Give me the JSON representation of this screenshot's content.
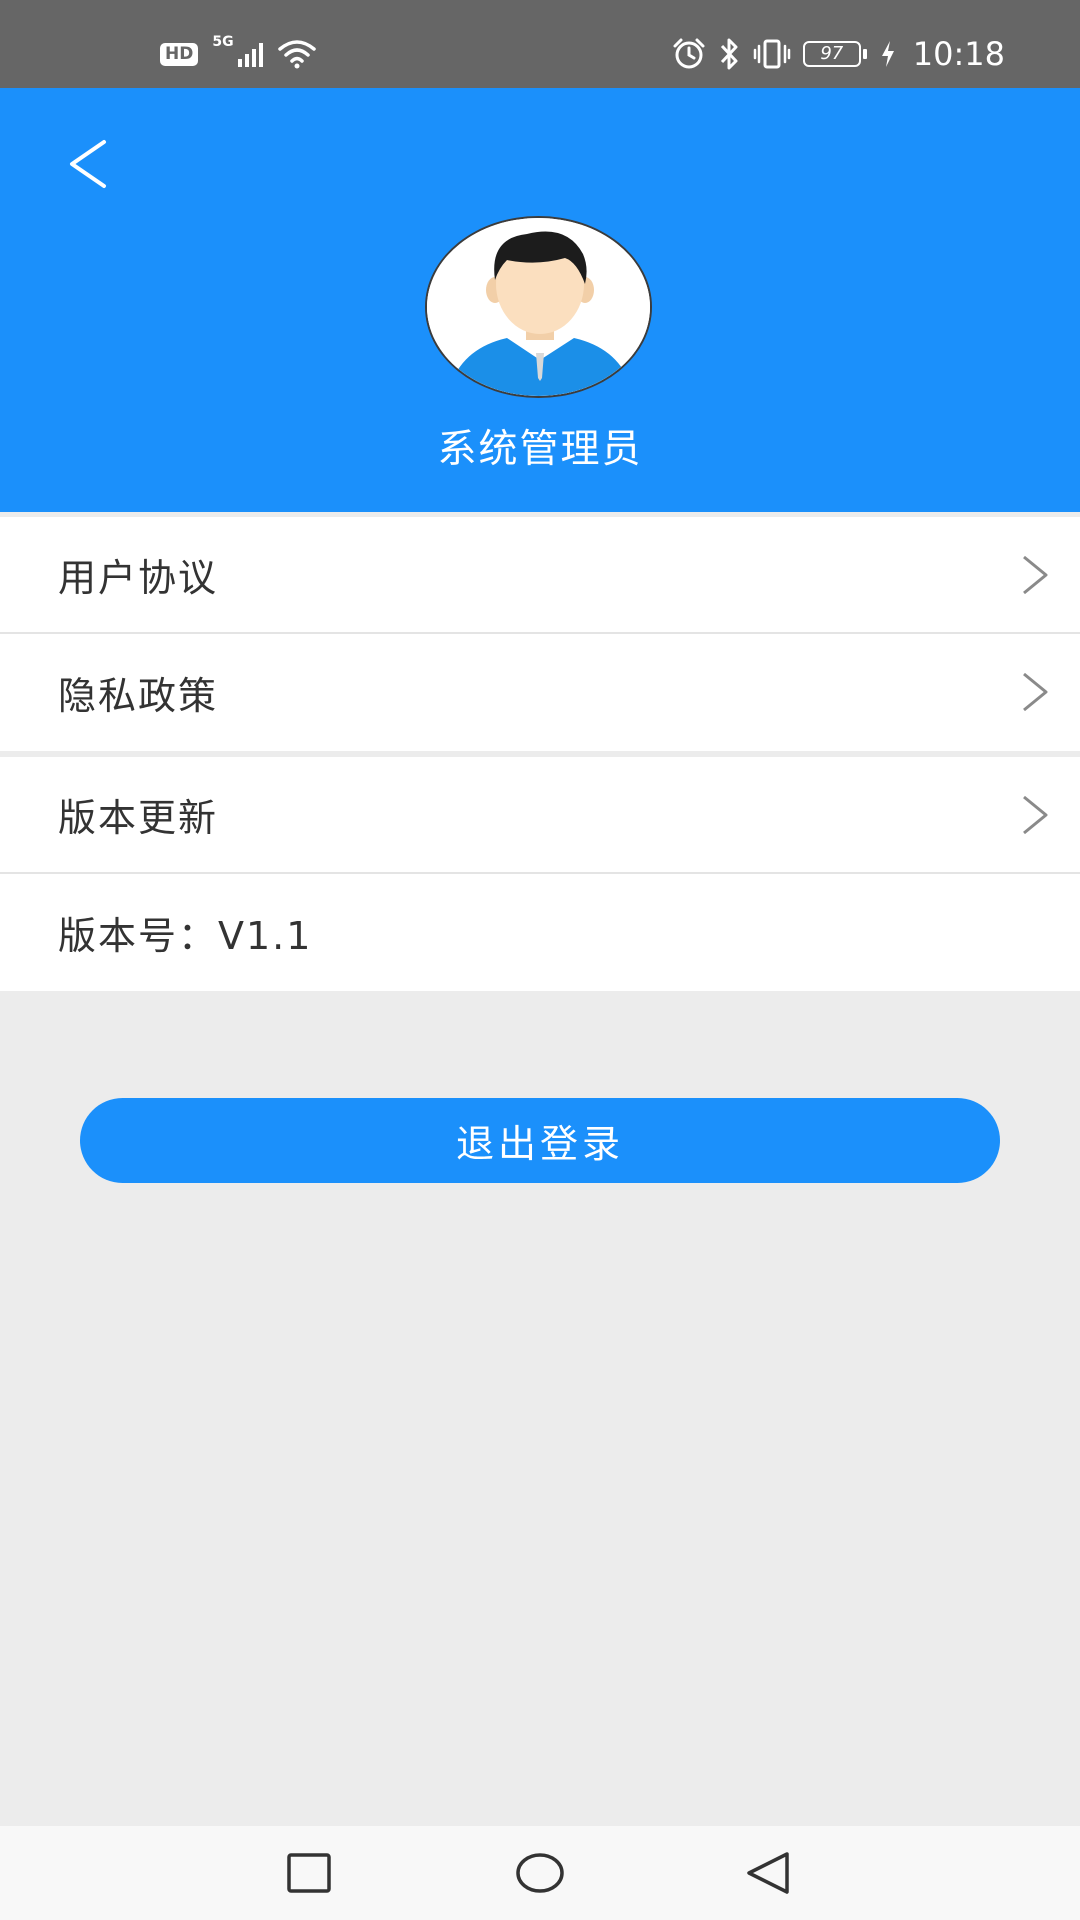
{
  "status_bar": {
    "hd": "HD",
    "network": "5G",
    "battery": "97",
    "time": "10:18",
    "icons": [
      "hd-icon",
      "signal-icon",
      "wifi-icon",
      "alarm-icon",
      "bluetooth-icon",
      "vibrate-icon",
      "battery-icon",
      "charging-icon"
    ]
  },
  "header": {
    "back_icon": "chevron-left-icon",
    "avatar": "user-avatar",
    "user_name": "系统管理员",
    "background_color": "#1b90fb"
  },
  "menu_group_1": [
    {
      "label": "用户协议",
      "icon": "chevron-right-icon"
    },
    {
      "label": "隐私政策",
      "icon": "chevron-right-icon"
    }
  ],
  "menu_group_2": [
    {
      "label": "版本更新",
      "icon": "chevron-right-icon"
    },
    {
      "label": "版本号：V1.1"
    }
  ],
  "logout": {
    "label": "退出登录",
    "color": "#1b90fb"
  },
  "nav_bar": {
    "icons": [
      "recent-apps-icon",
      "home-icon",
      "back-icon"
    ]
  }
}
